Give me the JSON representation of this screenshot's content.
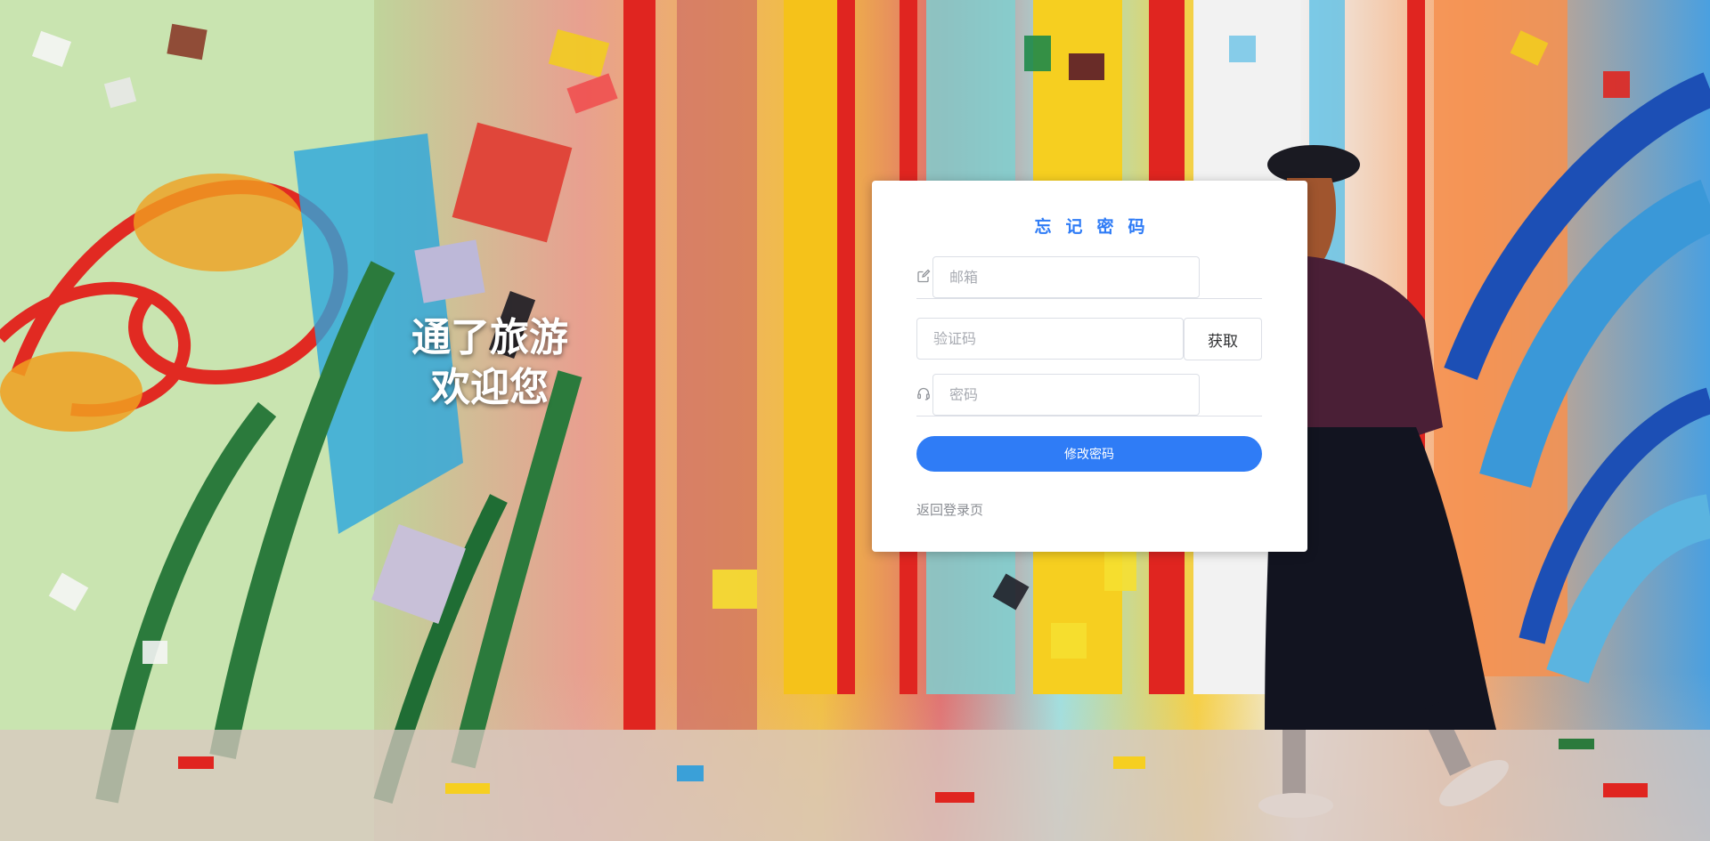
{
  "slogan": {
    "line1": "通了旅游",
    "line2": "欢迎您"
  },
  "form": {
    "title": "忘记密码",
    "email": {
      "placeholder": "邮箱",
      "icon": "edit-icon"
    },
    "code": {
      "placeholder": "验证码",
      "get_label": "获取"
    },
    "password": {
      "placeholder": "密码",
      "icon": "headset-icon"
    },
    "submit_label": "修改密码",
    "back_label": "返回登录页"
  },
  "colors": {
    "accent": "#2f7cf6",
    "title": "#2f7cf6",
    "link": "#8a8d93"
  }
}
